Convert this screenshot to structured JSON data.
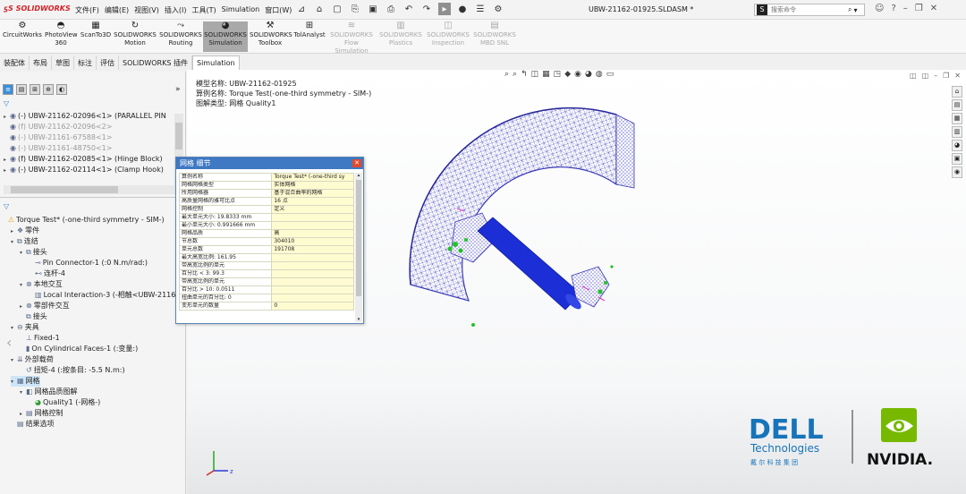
{
  "app": {
    "logo": "SOLIDWORKS",
    "menus": [
      "文件(F)",
      "编辑(E)",
      "视图(V)",
      "插入(I)",
      "工具(T)",
      "Simulation",
      "窗口(W)"
    ],
    "document_title": "UBW-21162-01925.SLDASM *",
    "search_placeholder": "搜索命令",
    "search_logo": "S",
    "pin": "⊿"
  },
  "ribbon": {
    "buttons": [
      {
        "label1": "CircuitWorks",
        "label2": "",
        "icon": "gear-icon",
        "state": "normal"
      },
      {
        "label1": "PhotoView",
        "label2": "360",
        "icon": "teapot-icon",
        "state": "normal"
      },
      {
        "label1": "ScanTo3D",
        "label2": "",
        "icon": "scan-icon",
        "state": "normal"
      },
      {
        "label1": "SOLIDWORKS",
        "label2": "Motion",
        "icon": "motion-icon",
        "state": "normal"
      },
      {
        "label1": "SOLIDWORKS",
        "label2": "Routing",
        "icon": "routing-icon",
        "state": "normal"
      },
      {
        "label1": "SOLIDWORKS",
        "label2": "Simulation",
        "icon": "simulation-icon",
        "state": "active"
      },
      {
        "label1": "SOLIDWORKS",
        "label2": "Toolbox",
        "icon": "toolbox-icon",
        "state": "normal"
      },
      {
        "label1": "TolAnalyst",
        "label2": "",
        "icon": "tolanalyst-icon",
        "state": "normal"
      },
      {
        "label1": "SOLIDWORKS",
        "label2": "Flow Simulation",
        "icon": "flow-icon",
        "state": "disabled"
      },
      {
        "label1": "SOLIDWORKS",
        "label2": "Plastics",
        "icon": "plastics-icon",
        "state": "disabled"
      },
      {
        "label1": "SOLIDWORKS",
        "label2": "Inspection",
        "icon": "inspection-icon",
        "state": "disabled"
      },
      {
        "label1": "SOLIDWORKS",
        "label2": "MBD SNL",
        "icon": "mbd-icon",
        "state": "disabled"
      }
    ]
  },
  "command_tabs": [
    "装配体",
    "布局",
    "草图",
    "标注",
    "评估",
    "SOLIDWORKS 插件",
    "Simulation"
  ],
  "feature_tree": [
    {
      "label": "(-) UBW-21162-02096<1> (PARALLEL PIN",
      "icon": "part-icon",
      "arrow": "▸",
      "style": "normal"
    },
    {
      "label": "(f) UBW-21162-02096<2>",
      "icon": "part-icon",
      "arrow": "",
      "style": "grey"
    },
    {
      "label": "(-) UBW-21161-67588<1>",
      "icon": "part-icon",
      "arrow": "",
      "style": "grey"
    },
    {
      "label": "(-) UBW-21161-48750<1>",
      "icon": "part-icon",
      "arrow": "",
      "style": "grey"
    },
    {
      "label": "(f) UBW-21162-02085<1> (Hinge Block)",
      "icon": "part-icon",
      "arrow": "▸",
      "style": "normal"
    },
    {
      "label": "(-) UBW-21162-02114<1> (Clamp Hook)",
      "icon": "part-icon",
      "arrow": "▸",
      "style": "normal"
    }
  ],
  "sim_tree": [
    {
      "label": "Torque Test* (-one-third symmetry - SIM-)",
      "icon": "warning-icon",
      "indent": 0,
      "arrow": "",
      "style": "normal"
    },
    {
      "label": "零件",
      "icon": "parts-icon",
      "indent": 1,
      "arrow": "▸",
      "style": "normal"
    },
    {
      "label": "连结",
      "icon": "connections-icon",
      "indent": 1,
      "arrow": "▾",
      "style": "normal"
    },
    {
      "label": "接头",
      "icon": "connector-icon",
      "indent": 2,
      "arrow": "▾",
      "style": "normal"
    },
    {
      "label": "Pin Connector-1 (:0 N.m/rad:)",
      "icon": "pin-icon",
      "indent": 3,
      "arrow": "",
      "style": "normal"
    },
    {
      "label": "连杆-4",
      "icon": "link-icon",
      "indent": 3,
      "arrow": "",
      "style": "normal"
    },
    {
      "label": "本地交互",
      "icon": "interaction-icon",
      "indent": 2,
      "arrow": "▾",
      "style": "normal"
    },
    {
      "label": "Local Interaction-3 (-相触<UBW-21162",
      "icon": "contact-icon",
      "indent": 3,
      "arrow": "",
      "style": "normal"
    },
    {
      "label": "零部件交互",
      "icon": "component-icon",
      "indent": 2,
      "arrow": "▸",
      "style": "normal"
    },
    {
      "label": "接头",
      "icon": "connector-icon",
      "indent": 2,
      "arrow": "",
      "style": "normal"
    },
    {
      "label": "夹具",
      "icon": "fixture-icon",
      "indent": 1,
      "arrow": "▾",
      "style": "normal"
    },
    {
      "label": "Fixed-1",
      "icon": "fixed-icon",
      "indent": 2,
      "arrow": "",
      "style": "normal"
    },
    {
      "label": "On Cylindrical Faces-1 (:变量:)",
      "icon": "cylindrical-icon",
      "indent": 2,
      "arrow": "",
      "style": "normal"
    },
    {
      "label": "外部载荷",
      "icon": "load-icon",
      "indent": 1,
      "arrow": "▾",
      "style": "normal"
    },
    {
      "label": "扭矩-4 (:按条目: -5.5 N.m:)",
      "icon": "torque-icon",
      "indent": 2,
      "arrow": "",
      "style": "normal"
    },
    {
      "label": "网格",
      "icon": "mesh-icon",
      "indent": 1,
      "arrow": "▾",
      "style": "hl"
    },
    {
      "label": "网格品质图解",
      "icon": "plot-icon",
      "indent": 2,
      "arrow": "▾",
      "style": "normal"
    },
    {
      "label": "Quality1 (-网格-)",
      "icon": "quality-icon",
      "indent": 3,
      "arrow": "",
      "style": "normal"
    },
    {
      "label": "网格控制",
      "icon": "mesh-control-icon",
      "indent": 2,
      "arrow": "▸",
      "style": "normal"
    },
    {
      "label": "结果选项",
      "icon": "result-options-icon",
      "indent": 1,
      "arrow": "",
      "style": "normal"
    }
  ],
  "viewport": {
    "info_lines": [
      "模型名称: UBW-21162-01925",
      "算例名称: Torque Test(-one-third symmetry - SIM-)",
      "图解类型: 网格 Quality1"
    ],
    "triad_z": "z"
  },
  "mesh_dialog": {
    "title": "网格 细节",
    "rows": [
      {
        "k": "算例名称",
        "v": "Torque Test* (-one-third sy"
      },
      {
        "k": "网格网格类型",
        "v": "实体网格"
      },
      {
        "k": "所用网格器",
        "v": "基于混合曲率的网格"
      },
      {
        "k": "高质量网格的雅可比点",
        "v": "16 点"
      },
      {
        "k": "网格控制",
        "v": "定义"
      },
      {
        "k": "最大单元大小: 19.8333 mm",
        "v": ""
      },
      {
        "k": "最小单元大小: 0.991666 mm",
        "v": ""
      },
      {
        "k": "网格品质",
        "v": "高"
      },
      {
        "k": "节总数",
        "v": "304010"
      },
      {
        "k": "单元总数",
        "v": "191708"
      },
      {
        "k": "最大高宽比例: 161.95",
        "v": ""
      },
      {
        "k": "带高宽比例的单元",
        "v": ""
      },
      {
        "k": "百分比 < 3: 99.3",
        "v": ""
      },
      {
        "k": "带高宽比例的单元",
        "v": ""
      },
      {
        "k": "百分比 > 10: 0.0511",
        "v": ""
      },
      {
        "k": "扭曲单元的百分比: 0",
        "v": ""
      },
      {
        "k": "变形单元的数量",
        "v": "0"
      }
    ]
  },
  "brand": {
    "dell": "DELL",
    "technologies": "Technologies",
    "dell_cn": "戴 尔 科 技 集 团",
    "nvidia": "NVIDIA."
  },
  "colors": {
    "accent": "#3f78c3",
    "dell_blue": "#1774b9",
    "nvidia_green": "#76b900",
    "mesh_line": "#3b3bb8",
    "pin_blue": "#1c2fd6",
    "fixture_green": "#22c322",
    "load_magenta": "#e040c8"
  }
}
